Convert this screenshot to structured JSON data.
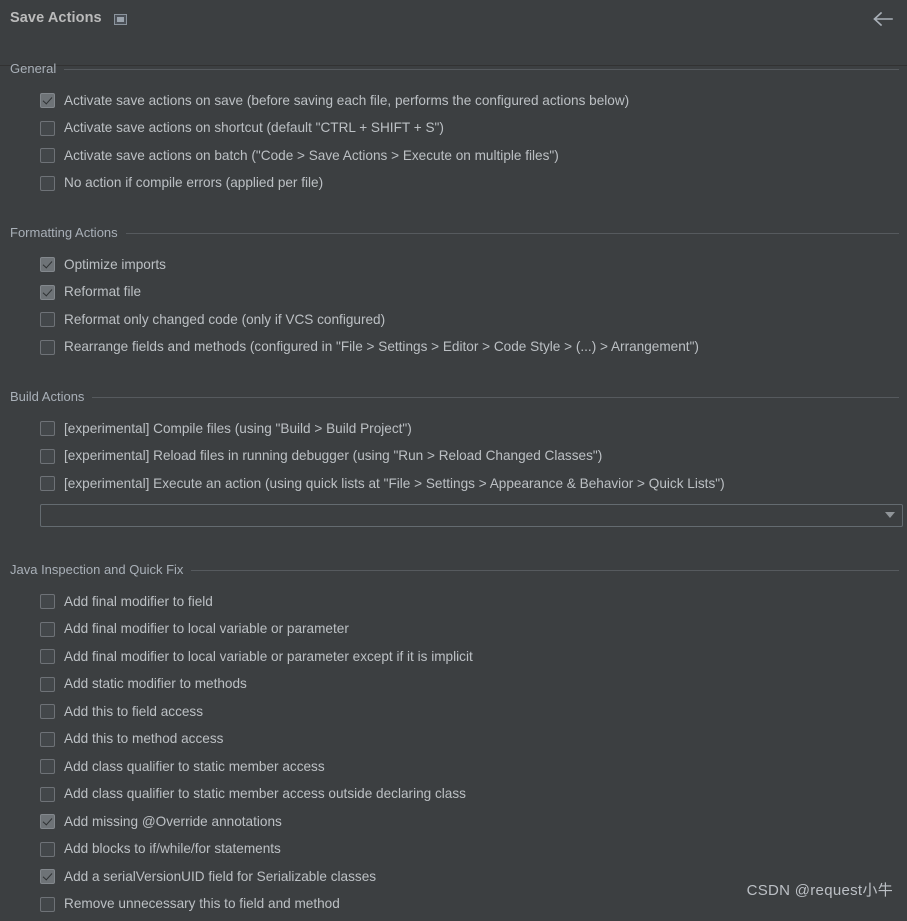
{
  "header": {
    "title": "Save Actions",
    "window_icon": "window-icon",
    "back_icon": "arrow-left-icon"
  },
  "sections": [
    {
      "id": "general",
      "title": "General",
      "items": [
        {
          "label": "Activate save actions on save (before saving each file, performs the configured actions below)",
          "checked": true
        },
        {
          "label": "Activate save actions on shortcut (default \"CTRL + SHIFT + S\")",
          "checked": false
        },
        {
          "label": "Activate save actions on batch (\"Code > Save Actions > Execute on multiple files\")",
          "checked": false
        },
        {
          "label": "No action if compile errors (applied per file)",
          "checked": false
        }
      ]
    },
    {
      "id": "formatting-actions",
      "title": "Formatting Actions",
      "items": [
        {
          "label": "Optimize imports",
          "checked": true
        },
        {
          "label": "Reformat file",
          "checked": true
        },
        {
          "label": "Reformat only changed code (only if VCS configured)",
          "checked": false
        },
        {
          "label": "Rearrange fields and methods (configured in \"File > Settings > Editor > Code Style > (...) > Arrangement\")",
          "checked": false
        }
      ]
    },
    {
      "id": "build-actions",
      "title": "Build Actions",
      "items": [
        {
          "label": "[experimental] Compile files (using \"Build > Build Project\")",
          "checked": false
        },
        {
          "label": "[experimental] Reload files in running debugger (using \"Run > Reload Changed Classes\")",
          "checked": false
        },
        {
          "label": "[experimental] Execute an action (using quick lists at \"File > Settings > Appearance & Behavior > Quick Lists\")",
          "checked": false
        }
      ],
      "combo": {
        "value": "",
        "arrow_icon": "chevron-down-icon"
      }
    },
    {
      "id": "java-inspection-and-quick-fix",
      "title": "Java Inspection and Quick Fix",
      "items": [
        {
          "label": "Add final modifier to field",
          "checked": false
        },
        {
          "label": "Add final modifier to local variable or parameter",
          "checked": false
        },
        {
          "label": "Add final modifier to local variable or parameter except if it is implicit",
          "checked": false
        },
        {
          "label": "Add static modifier to methods",
          "checked": false
        },
        {
          "label": "Add this to field access",
          "checked": false
        },
        {
          "label": "Add this to method access",
          "checked": false
        },
        {
          "label": "Add class qualifier to static member access",
          "checked": false
        },
        {
          "label": "Add class qualifier to static member access outside declaring class",
          "checked": false
        },
        {
          "label": "Add missing @Override annotations",
          "checked": true
        },
        {
          "label": "Add blocks to if/while/for statements",
          "checked": false
        },
        {
          "label": "Add a serialVersionUID field for Serializable classes",
          "checked": true
        },
        {
          "label": "Remove unnecessary this to field and method",
          "checked": false
        }
      ]
    }
  ],
  "watermark": "CSDN @request小牛",
  "colors": {
    "background": "#3c3f41",
    "text": "#bcc0c4",
    "section_title": "#a9b0b8",
    "rule": "#565a5e",
    "checkbox_border": "#6e7277",
    "checkbox_checked": "#6e7377"
  }
}
